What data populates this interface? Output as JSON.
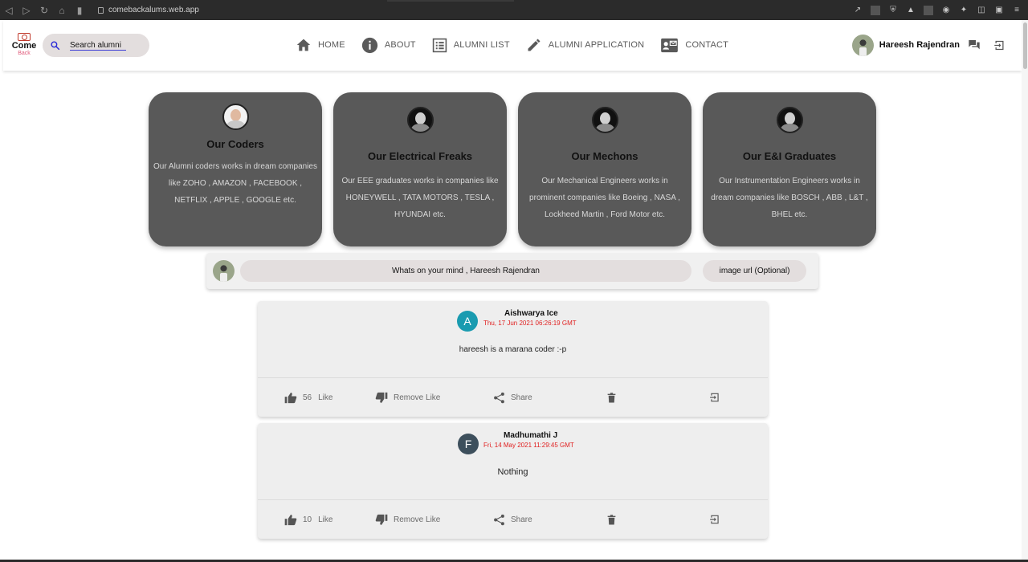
{
  "browser": {
    "url": "comebackalums.web.app"
  },
  "header": {
    "logo_top": "Come",
    "logo_bottom": "Back",
    "search_placeholder": "Search alumni",
    "nav": [
      {
        "label": "HOME",
        "icon": "home-icon"
      },
      {
        "label": "ABOUT",
        "icon": "info-icon"
      },
      {
        "label": "ALUMNI LIST",
        "icon": "list-icon"
      },
      {
        "label": "ALUMNI APPLICATION",
        "icon": "edit-icon"
      },
      {
        "label": "CONTACT",
        "icon": "contact-card-icon"
      }
    ],
    "user_name": "Hareesh Rajendran"
  },
  "cards": [
    {
      "title": "Our Coders",
      "text": "Our Alumni coders works in dream companies like ZOHO , AMAZON , FACEBOOK , NETFLIX , APPLE , GOOGLE etc."
    },
    {
      "title": "Our Electrical Freaks",
      "text": "Our EEE graduates works in companies like HONEYWELL , TATA MOTORS , TESLA , HYUNDAI etc."
    },
    {
      "title": "Our Mechons",
      "text": "Our Mechanical Engineers works in prominent companies like Boeing , NASA , Lockheed Martin , Ford Motor etc."
    },
    {
      "title": "Our E&I Graduates",
      "text": "Our Instrumentation Engineers works in dream companies like BOSCH , ABB , L&T , BHEL etc."
    }
  ],
  "composer": {
    "mind_placeholder": "Whats on your mind , Hareesh Rajendran",
    "image_placeholder": "image url (Optional)"
  },
  "posts": [
    {
      "initial": "A",
      "author": "Aishwarya Ice",
      "date": "Thu, 17 Jun 2021 06:26:19 GMT",
      "body": "hareesh is a marana coder :-p",
      "likes": "56",
      "color": "#1a9bb0"
    },
    {
      "initial": "F",
      "author": "Madhumathi J",
      "date": "Fri, 14 May 2021 11:29:45 GMT",
      "body": "Nothing",
      "likes": "10",
      "color": "#3d4f5c"
    }
  ],
  "actions": {
    "like": "Like",
    "remove_like": "Remove Like",
    "share": "Share"
  }
}
